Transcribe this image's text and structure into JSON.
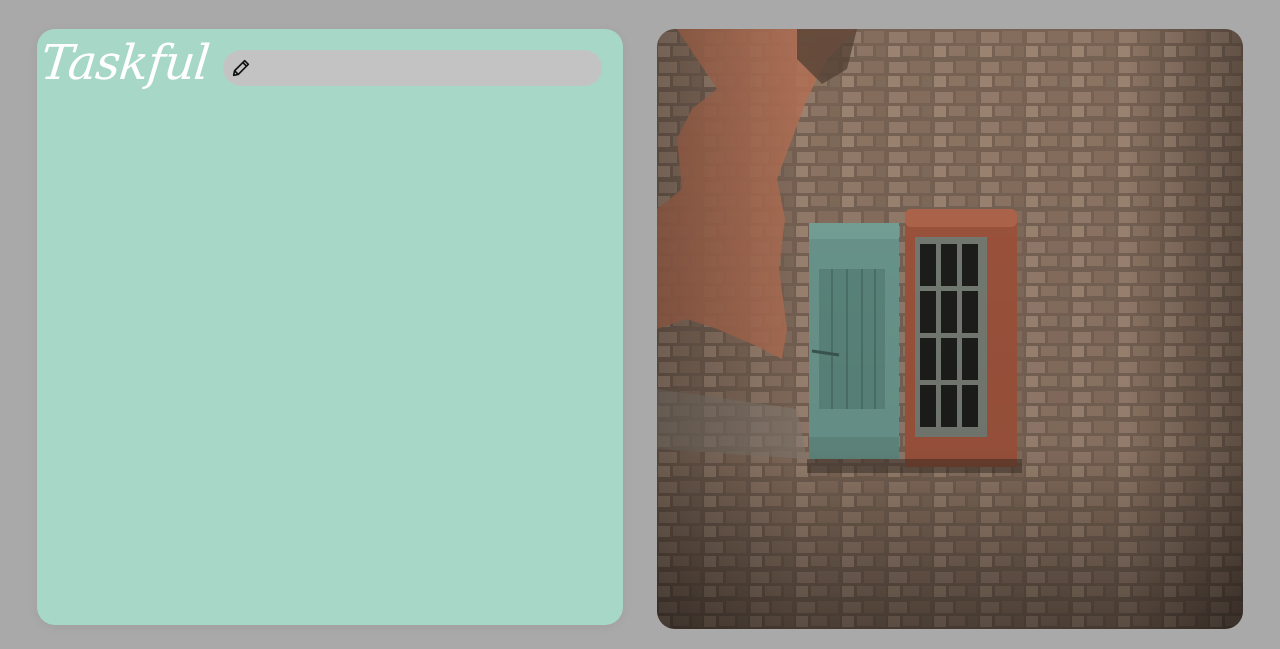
{
  "app": {
    "logo_text": "Taskful"
  },
  "task_input": {
    "value": "",
    "placeholder": "",
    "icon": "pencil-icon"
  },
  "tasks": [],
  "photo": {
    "subject": "stone-wall-with-shuttered-window",
    "colors": {
      "shutter": "#6f9d93",
      "plaster": "#c07a5c",
      "stone": "#8f7867"
    }
  },
  "colors": {
    "backdrop": "#a9a9a9",
    "card": "#a7d7c7",
    "input": "#c3c3c3"
  }
}
